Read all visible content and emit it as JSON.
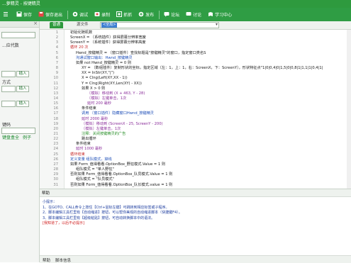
{
  "window": {
    "title": "...萝精灵 - 按键精灵"
  },
  "toolbar": {
    "items": [
      {
        "label": "",
        "icon": "menu-icon"
      },
      {
        "label": "保存",
        "icon": "save-icon"
      },
      {
        "label": "保存退出",
        "icon": "save-exit-icon"
      },
      {
        "label": "调试",
        "icon": "debug-icon"
      },
      {
        "label": "录制",
        "icon": "record-icon"
      },
      {
        "label": "抓抓",
        "icon": "capture-icon"
      },
      {
        "label": "发布",
        "icon": "publish-icon"
      },
      {
        "label": "论坛",
        "icon": "forum-icon"
      },
      {
        "label": "讨论",
        "icon": "discuss-icon"
      },
      {
        "label": "学习中心",
        "icon": "learn-icon"
      }
    ]
  },
  "left_panel": {
    "item1": "...应代数",
    "item2": "方式",
    "insert1": "插入",
    "insert2": "插入",
    "insert3": "插入",
    "label_kw": "键码",
    "link1": "键盘盒全",
    "link2": "例子"
  },
  "editor": {
    "tab_active": "普通",
    "tab_source": "源文件",
    "combo_value": "<全局>",
    "code_lines": [
      {
        "text": "初始化随机数",
        "color": "black",
        "indent": 1
      },
      {
        "text": "ScreenX = 〔系统插件〕获得屏幕分辨率宽度",
        "color": "black",
        "indent": 1
      },
      {
        "text": "ScreenY = 〔系统插件〕获得屏幕分辨率高度",
        "color": "black",
        "indent": 1
      },
      {
        "text": "循环 20 次",
        "color": "red",
        "indent": 1
      },
      {
        "text": "Hwnd_按键精灵 = 〔窗口插件〕查找标题是\"按键精灵\"的窗口，指定窗口类名S",
        "color": "black",
        "indent": 2
      },
      {
        "text": "沟通试窗口输出：Hwnd_按键精灵",
        "color": "blue",
        "indent": 2
      },
      {
        "text": "如果 not Hwnd_按键精灵 = 0 则",
        "color": "black",
        "indent": 2
      },
      {
        "text": "XY = 〔数组插件〕复制形状的坐标，指定区域〔左：1，上：1，右：ScreenX，下：ScreenY〕，形状特征点\"1|0|0,4|0|1,5|0|0,8|1|1,1|1|0,4|1|",
        "color": "black",
        "indent": 3
      },
      {
        "text": "XX = InStr(XY,\"|\")",
        "color": "black",
        "indent": 3
      },
      {
        "text": "X = Clng(Left(XY,XX - 1))",
        "color": "black",
        "indent": 3
      },
      {
        "text": "Y = Clng(Right(XY,Len(XY) - XX))",
        "color": "black",
        "indent": 3
      },
      {
        "text": "如果 X > 0 则",
        "color": "black",
        "indent": 3
      },
      {
        "text": "〔模拟〕移动到 (X + 463, Y - 28)",
        "color": "purple",
        "indent": 4
      },
      {
        "text": "〔模拟〕左键单击，1次",
        "color": "purple",
        "indent": 4
      },
      {
        "text": "延时 200 毫秒",
        "color": "purple",
        "indent": 4
      },
      {
        "text": "条件结束",
        "color": "black",
        "indent": 3
      },
      {
        "text": "调用 〔窗口插件〕隐藏窗口Hwnd_按键精灵",
        "color": "blue",
        "indent": 3
      },
      {
        "text": "延时 2000 毫秒",
        "color": "purple",
        "indent": 3
      },
      {
        "text": "〔模拟〕移动到 (ScreenX - 25, ScreenY - 200)",
        "color": "purple",
        "indent": 3
      },
      {
        "text": "〔模拟〕左键单击，1次",
        "color": "purple",
        "indent": 3
      },
      {
        "text": "注释：关闭按键精灵的广告",
        "color": "green",
        "indent": 3
      },
      {
        "text": "跳出循环",
        "color": "black",
        "indent": 3
      },
      {
        "text": "条件结束",
        "color": "black",
        "indent": 2
      },
      {
        "text": "延时 1000 毫秒",
        "color": "purple",
        "indent": 2
      },
      {
        "text": "循环结束",
        "color": "red",
        "indent": 1
      },
      {
        "text": "定义变量 组队模式，掉线",
        "color": "blue",
        "indent": 1
      },
      {
        "text": "如果 Form_值得看看.OptionBox_野狂模式.Value = 1 则",
        "color": "black",
        "indent": 1
      },
      {
        "text": "组队模式 = \"单人野狂\"",
        "color": "black",
        "indent": 2
      },
      {
        "text": "否则如果 Form_值得看看.OptionBox_队员模式.Value = 1 则",
        "color": "black",
        "indent": 1
      },
      {
        "text": "组队模式 = \"队员模式\"",
        "color": "black",
        "indent": 2
      },
      {
        "text": "否则如果 Form_值得看看.OptionBox_队长模式.value = 1 则",
        "color": "black",
        "indent": 1
      }
    ]
  },
  "help": {
    "header": "帮助",
    "lines": [
      {
        "text": "小提示：",
        "warn": false
      },
      {
        "text": "1、在GOTO、CALL命令上按住【Ctrl+鼠标左键】可跳转到相应标签或子程序。",
        "warn": false
      },
      {
        "text": "2、脚本编辑工具栏里有【自动缩进】按钮，可以帮你美观的自动缩进脚本（快捷键F4）。",
        "warn": false
      },
      {
        "text": "3、脚本编辑工具栏里有【超级粘贴】按钮，可自动转换脚本中的语法。",
        "warn": false
      },
      {
        "text": "[我知道了，以后不必提示]",
        "warn": true
      }
    ],
    "footer_tab1": "帮助",
    "footer_tab2": "脚本信息"
  }
}
